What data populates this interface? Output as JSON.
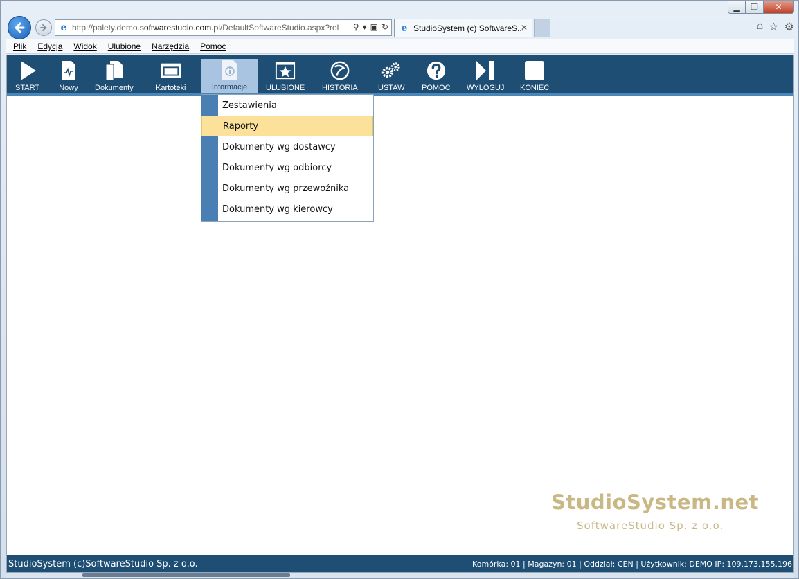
{
  "browser": {
    "window_controls": {
      "minimize": "▁",
      "maximize": "❐",
      "close": "✕"
    },
    "url_prefix": "http://palety.demo.",
    "url_domain": "softwarestudio.com.pl",
    "url_suffix": "/DefaultSoftwareStudio.aspx?rol",
    "tab_title": "StudioSystem (c) SoftwareS...",
    "tab_close": "✕"
  },
  "menubar": [
    "Plik",
    "Edycja",
    "Widok",
    "Ulubione",
    "Narzędzia",
    "Pomoc"
  ],
  "toolbar": [
    {
      "label": "START",
      "icon": "play-icon"
    },
    {
      "label": "Nowy",
      "icon": "new-document-icon"
    },
    {
      "label": "Dokumenty",
      "icon": "documents-icon"
    },
    {
      "label": "Kartoteki",
      "icon": "window-icon"
    },
    {
      "label": "Informacje",
      "icon": "info-icon"
    },
    {
      "label": "ULUBIONE",
      "icon": "star-icon"
    },
    {
      "label": "HISTORIA",
      "icon": "history-icon"
    },
    {
      "label": "USTAW",
      "icon": "gears-icon"
    },
    {
      "label": "POMOC",
      "icon": "help-icon"
    },
    {
      "label": "WYLOGUJ",
      "icon": "logout-icon"
    },
    {
      "label": "KONIEC",
      "icon": "stop-icon"
    }
  ],
  "dropdown": [
    "Zestawienia",
    "Raporty",
    "Dokumenty wg dostawcy",
    "Dokumenty wg odbiorcy",
    "Dokumenty wg przewoźnika",
    "Dokumenty wg kierowcy"
  ],
  "watermark": {
    "title": "StudioSystem.net",
    "subtitle": "SoftwareStudio Sp. z o.o."
  },
  "status": {
    "left": "StudioSystem (c)SoftwareStudio Sp. z o.o.",
    "right": "Komórka: 01 | Magazyn: 01 | Oddział: CEN | Użytkownik: DEMO IP: 109.173.155.196"
  },
  "colors": {
    "toolbar": "#1e4e73",
    "accent": "#4a86b8",
    "highlight": "#fbe19a",
    "watermark": "#c9b784"
  }
}
